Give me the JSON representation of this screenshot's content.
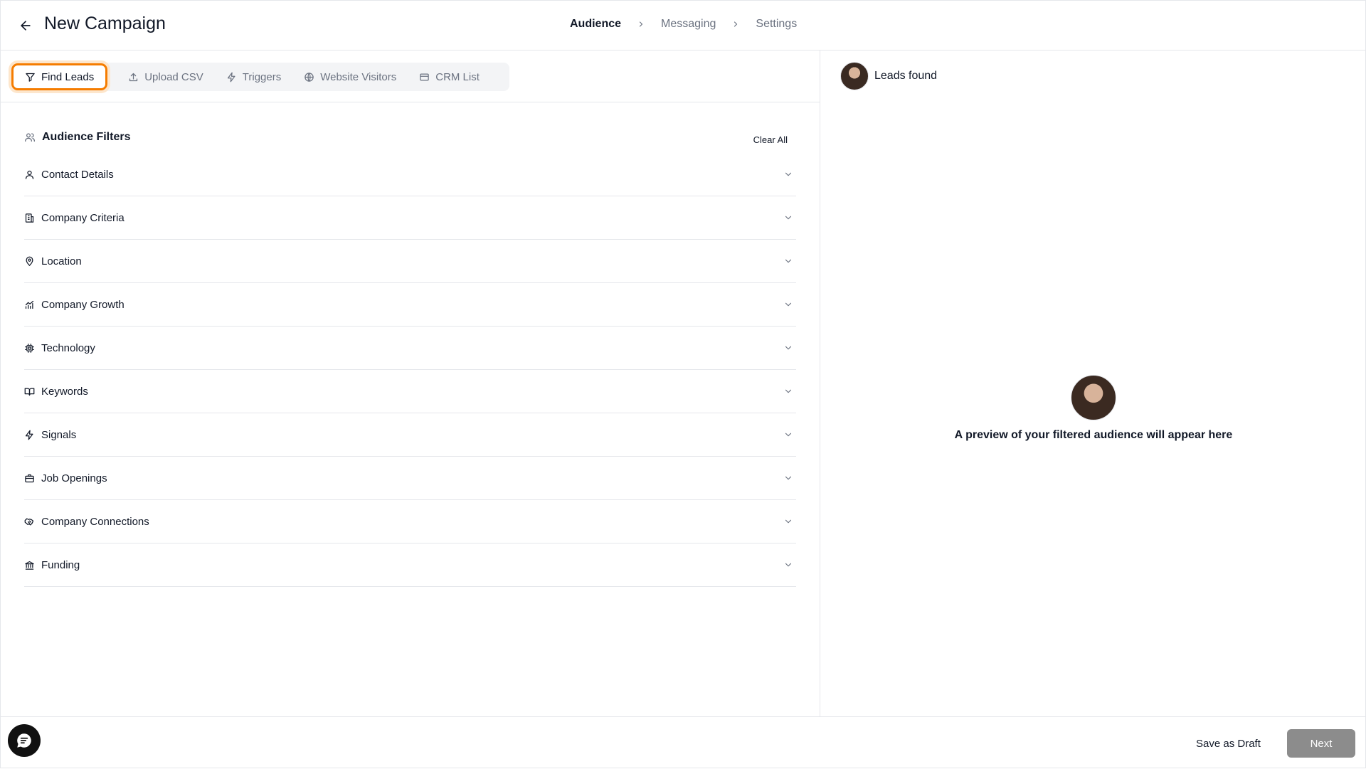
{
  "header": {
    "title": "New Campaign",
    "steps": [
      {
        "label": "Audience",
        "active": true
      },
      {
        "label": "Messaging",
        "active": false
      },
      {
        "label": "Settings",
        "active": false
      }
    ]
  },
  "tabs": [
    {
      "label": "Find Leads",
      "icon": "filter-icon",
      "active": true
    },
    {
      "label": "Upload CSV",
      "icon": "upload-icon",
      "active": false
    },
    {
      "label": "Triggers",
      "icon": "bolt-icon",
      "active": false
    },
    {
      "label": "Website Visitors",
      "icon": "globe-icon",
      "active": false
    },
    {
      "label": "CRM List",
      "icon": "card-icon",
      "active": false
    }
  ],
  "filters": {
    "title": "Audience Filters",
    "clear_label": "Clear All",
    "items": [
      {
        "label": "Contact Details",
        "icon": "user-icon"
      },
      {
        "label": "Company Criteria",
        "icon": "building-icon"
      },
      {
        "label": "Location",
        "icon": "map-pin-icon"
      },
      {
        "label": "Company Growth",
        "icon": "growth-chart-icon"
      },
      {
        "label": "Technology",
        "icon": "chip-icon"
      },
      {
        "label": "Keywords",
        "icon": "book-icon"
      },
      {
        "label": "Signals",
        "icon": "bolt-icon"
      },
      {
        "label": "Job Openings",
        "icon": "briefcase-icon"
      },
      {
        "label": "Company Connections",
        "icon": "handshake-icon"
      },
      {
        "label": "Funding",
        "icon": "bank-icon"
      }
    ]
  },
  "preview": {
    "leads_label": "Leads found",
    "empty_text": "A preview of your filtered audience will appear here"
  },
  "footer": {
    "draft_label": "Save as Draft",
    "next_label": "Next"
  },
  "colors": {
    "active_tab_ring": "#f57c00",
    "next_button": "#8c8c8c"
  }
}
